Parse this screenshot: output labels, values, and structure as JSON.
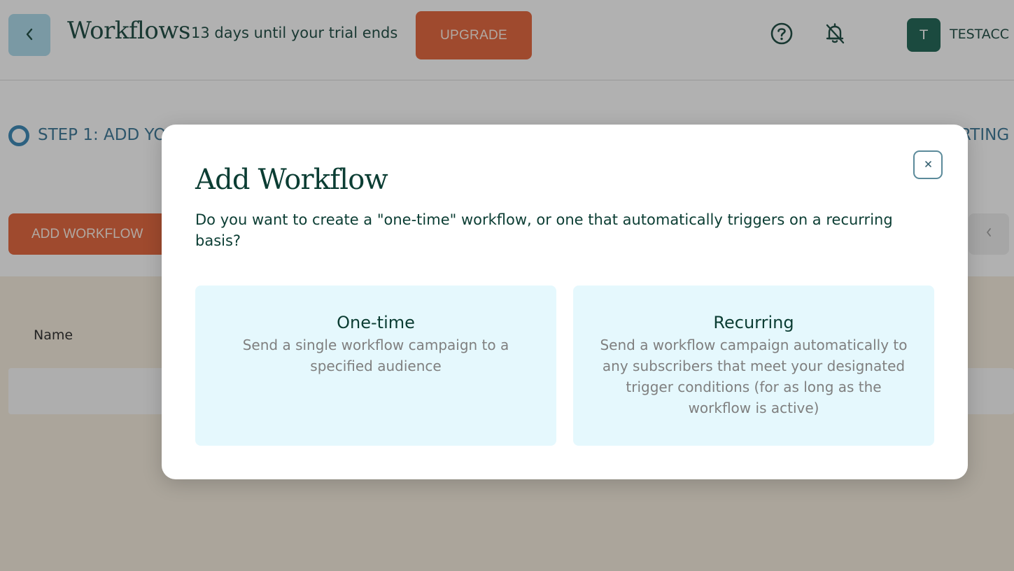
{
  "header": {
    "back_icon": "chevron-left-icon",
    "title": "Workflows",
    "trial_text": "13 days until your trial ends",
    "upgrade_label": "UPGRADE",
    "help_icon": "question-circle-icon",
    "notifications_icon": "bell-off-icon",
    "avatar_initial": "T",
    "account_name": "TESTACC"
  },
  "page": {
    "step_label": "STEP 1: ADD YO",
    "step_right_text": "RTING",
    "add_workflow_label": "ADD WORKFLOW",
    "pager_icon": "chevron-left-icon",
    "table": {
      "columns": [
        "Name"
      ]
    }
  },
  "modal": {
    "title": "Add Workflow",
    "question": "Do you want to create a \"one-time\" workflow, or one that automatically triggers on a recurring basis?",
    "close_icon": "close-icon",
    "options": [
      {
        "title": "One-time",
        "description": "Send a single workflow campaign to a specified audience"
      },
      {
        "title": "Recurring",
        "description": "Send a workflow campaign automatically to any subscribers that meet your designated trigger conditions (for as long as the workflow is active)"
      }
    ]
  },
  "colors": {
    "brand_dark_green": "#0b3d33",
    "accent_orange": "#e2592d",
    "back_button_blue": "#a7d8ea",
    "option_card_bg": "#e5f8fd",
    "step_blue": "#2d6d8f",
    "overlay": "rgba(50,50,50,0.38)"
  }
}
